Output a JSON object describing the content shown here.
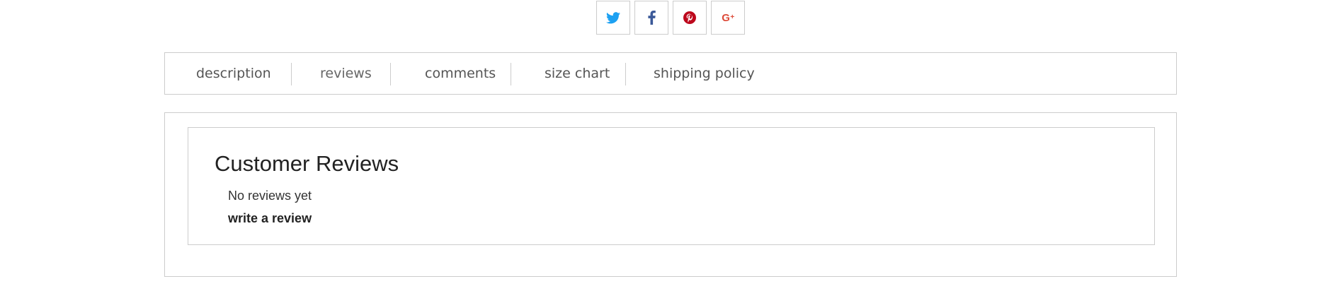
{
  "share": {
    "buttons": [
      {
        "icon": "twitter-icon",
        "color": "#1da1f2"
      },
      {
        "icon": "facebook-icon",
        "color": "#3b5998"
      },
      {
        "icon": "pinterest-icon",
        "color": "#bd081c"
      },
      {
        "icon": "google-plus-icon",
        "color": "#dd4b39",
        "glyph": "G",
        "glyph_sup": "+"
      }
    ]
  },
  "tabs": [
    {
      "label": "description"
    },
    {
      "label": "reviews",
      "active": true
    },
    {
      "label": "comments"
    },
    {
      "label": "size chart"
    },
    {
      "label": "shipping policy"
    }
  ],
  "reviews": {
    "title": "Customer Reviews",
    "empty_text": "No reviews yet",
    "write_label": "write a review"
  }
}
